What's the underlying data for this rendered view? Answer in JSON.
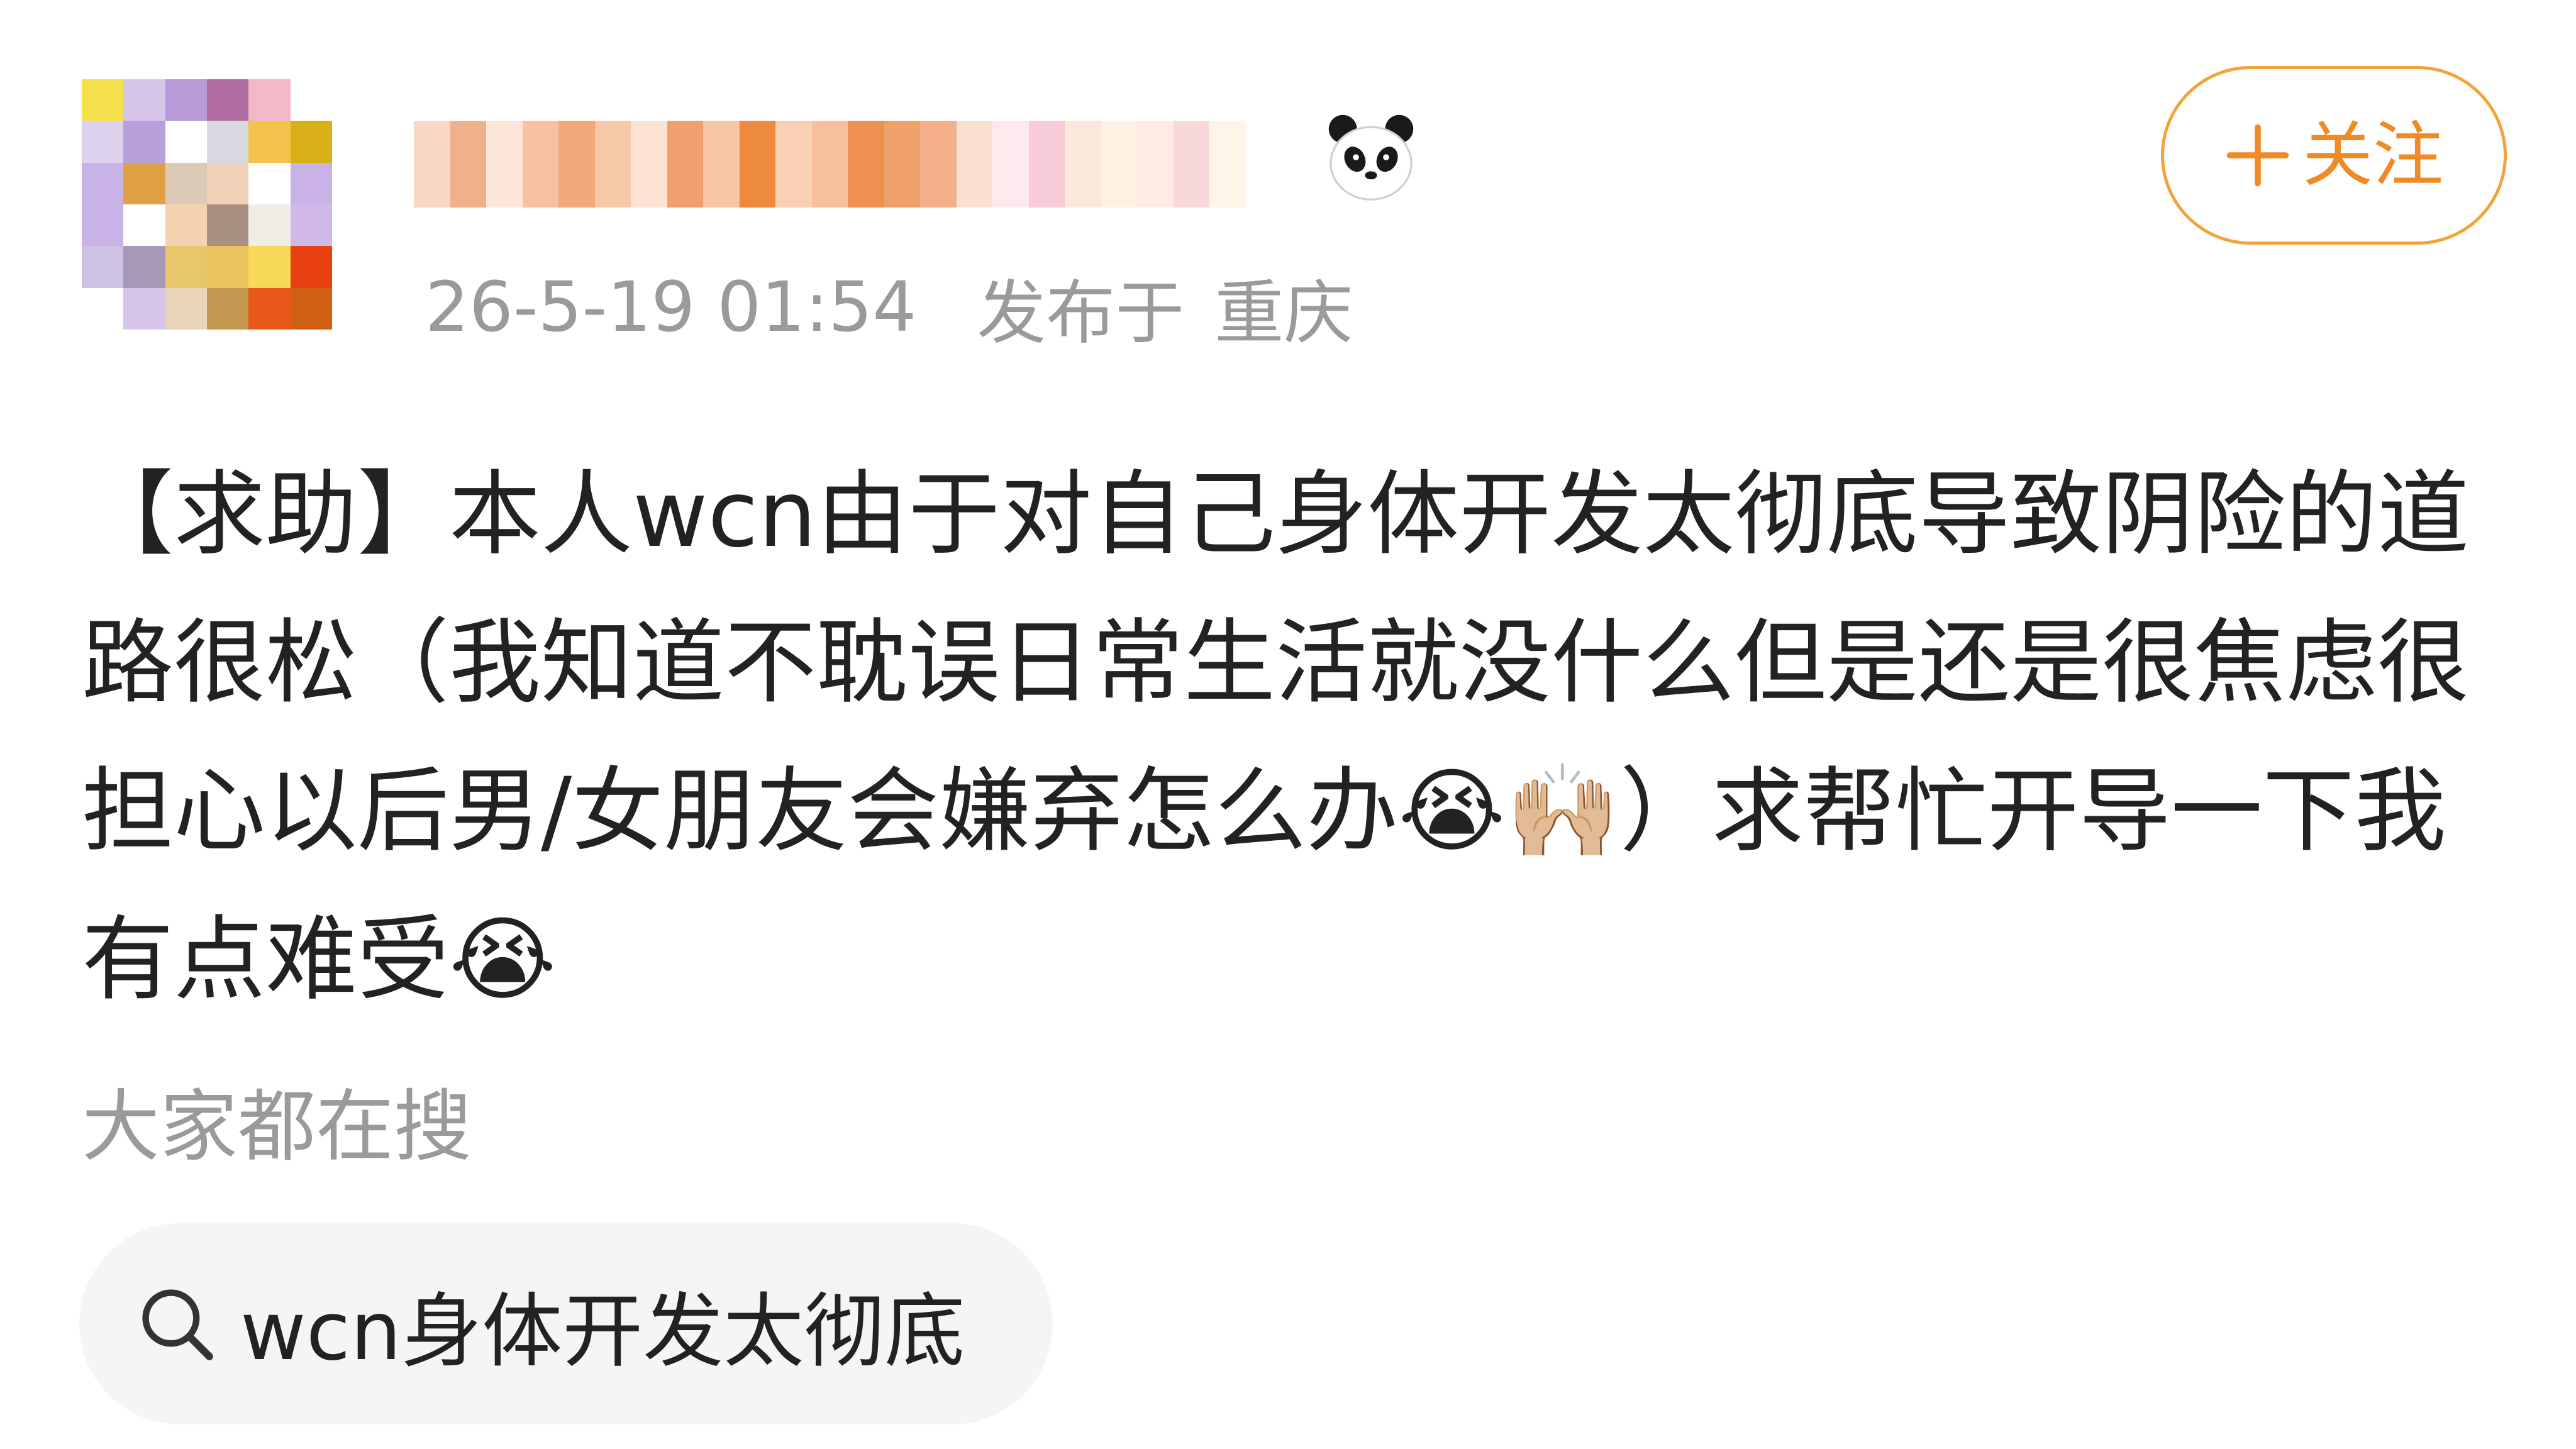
{
  "author": {
    "avatar": "avatar (pixelated)",
    "name": "",
    "badge_icon": "panda-icon"
  },
  "follow": {
    "label": "关注",
    "icon": "plus-icon",
    "accent": "#F08A24"
  },
  "meta": {
    "timestamp": "26-5-19 01:54",
    "location_prefix": "发布于",
    "location": "重庆"
  },
  "post": {
    "text": "【求助】本人wcn由于对自己身体开发太彻底导致阴险的道路很松（我知道不耽误日常生活就没什么但是还是很焦虑很担心以后男/女朋友会嫌弃怎么办😭🙌🏼）求帮忙开导一下我有点难受😭"
  },
  "search": {
    "heading": "大家都在搜",
    "icon": "search-icon",
    "query": "wcn身体开发太彻底"
  }
}
